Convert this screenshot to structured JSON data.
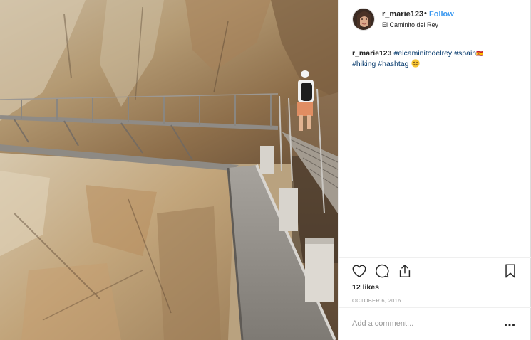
{
  "post": {
    "author": {
      "username": "r_marie123",
      "separator": "•",
      "follow_label": "Follow",
      "location": "El Caminito del Rey",
      "avatar_icon": "profile-avatar"
    },
    "caption": {
      "username": "r_marie123",
      "hashtags": [
        "#elcaminitodelrey",
        "#spain",
        "#hiking",
        "#hashtag"
      ],
      "flag_emoji": "🇪🇸",
      "end_emoji": "😛"
    },
    "actions": {
      "like_icon": "heart-icon",
      "comment_icon": "comment-icon",
      "share_icon": "share-icon",
      "save_icon": "bookmark-icon"
    },
    "likes_text": "12 likes",
    "date_text": "OCTOBER 6, 2016",
    "comment": {
      "placeholder": "Add a comment...",
      "value": ""
    },
    "more_icon": "more-options-icon",
    "colors": {
      "link_blue": "#3897f0",
      "hashtag_blue": "#003569",
      "text": "#262626",
      "muted": "#999999",
      "border": "#efefef"
    }
  }
}
